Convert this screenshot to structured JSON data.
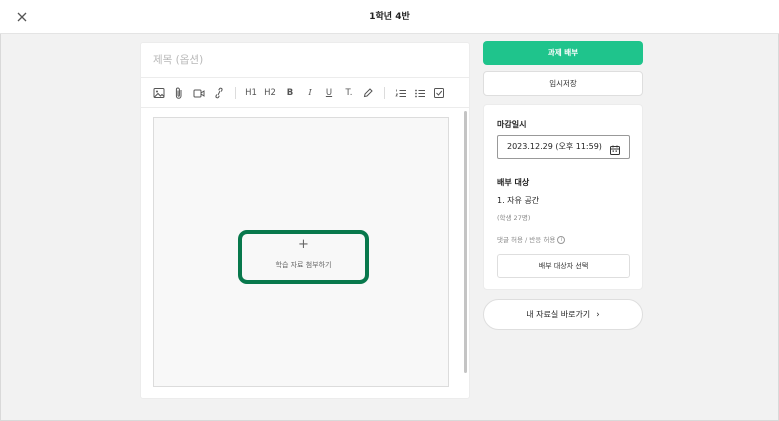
{
  "header": {
    "title": "1학년 4반",
    "close_icon": "×"
  },
  "editor": {
    "title_placeholder": "제목 (옵션)",
    "title_value": "",
    "toolbar": {
      "h1": "H1",
      "h2": "H2",
      "bold": "B",
      "italic": "I",
      "underline": "U",
      "clear_format": "T.",
      "icons": [
        "image-icon",
        "attachment-icon",
        "video-icon",
        "link-icon",
        "h1-icon",
        "h2-icon",
        "bold-icon",
        "italic-icon",
        "underline-icon",
        "clear-format-icon",
        "highlight-icon",
        "ordered-list-icon",
        "bullet-list-icon",
        "checklist-icon"
      ]
    },
    "attach": {
      "plus": "+",
      "label": "학습 자료 첨부하기"
    }
  },
  "sidebar": {
    "primary_button": "과제 배부",
    "save_button": "임시저장",
    "deadline": {
      "label": "마감일시",
      "value": "2023.12.29 (오후 11:59)"
    },
    "target": {
      "label": "배부 대상",
      "name": "1. 자유 공간",
      "count": "(학생 27명)",
      "options": "댓글 허용 / 반응 허용",
      "select_button": "배부 대상자 선택"
    },
    "shortcut_button": "내 자료실 바로가기",
    "shortcut_chevron": "›"
  },
  "colors": {
    "primary": "#1fc48c",
    "attach_border": "#08784c",
    "background": "#f2f2f2"
  }
}
